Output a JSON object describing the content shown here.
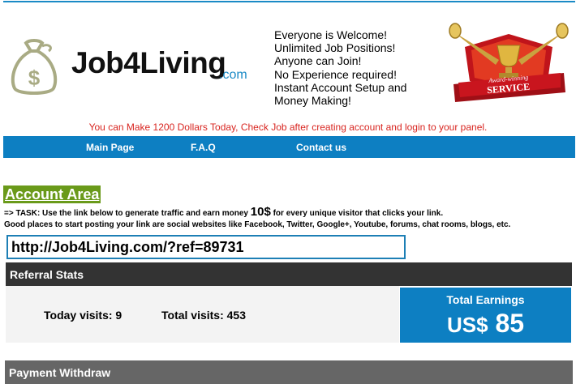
{
  "header": {
    "logo_name": "Job4Living",
    "logo_suffix": ".com",
    "bullets": [
      "Everyone is Welcome!",
      "Unlimited Job Positions!",
      "Anyone can Join!",
      "No Experience required!",
      "Instant Account Setup and",
      "Money Making!"
    ],
    "award_text_top": "Award-winning",
    "award_text_main": "SERVICE"
  },
  "promo_text": "You can Make 1200 Dollars Today, Check Job after creating account and login to your panel.",
  "nav": {
    "main_page": "Main Page",
    "faq": "F.A.Q",
    "contact": "Contact us"
  },
  "account": {
    "title": "Account Area",
    "task_prefix": "=> TASK: Use the link below to generate traffic and earn money ",
    "task_amount": "10$",
    "task_suffix": " for every unique visitor that clicks your link.",
    "places": "Good places to start posting your link are social websites like Facebook, Twitter, Google+, Youtube, forums, chat rooms, blogs, etc.",
    "referral_link": "http://Job4Living.com/?ref=89731"
  },
  "stats": {
    "title": "Referral Stats",
    "today_label": "Today visits: 9",
    "total_label": "Total visits: 453",
    "earnings_label": "Total Earnings",
    "earnings_currency": "US$",
    "earnings_value": "85"
  },
  "withdraw": {
    "title": "Payment Withdraw"
  },
  "colors": {
    "accent_blue": "#0d7fc2",
    "promo_red": "#d8241f",
    "account_green": "#6a9a1a",
    "stats_bar": "#333333",
    "withdraw_bar": "#666666"
  },
  "icons": {
    "logo": "money-bag-icon",
    "award": "award-trophy-icon"
  }
}
